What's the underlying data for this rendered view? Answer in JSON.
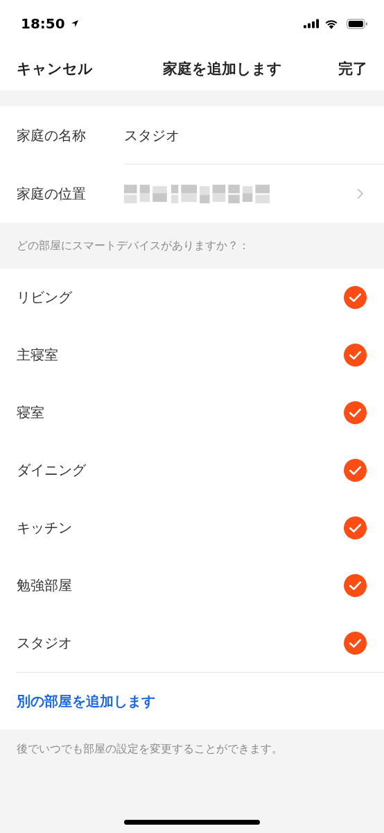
{
  "status_bar": {
    "time": "18:50"
  },
  "nav": {
    "cancel": "キャンセル",
    "title": "家庭を追加します",
    "done": "完了"
  },
  "form": [
    {
      "kind": "text",
      "label": "家庭の名称",
      "value": "スタジオ"
    },
    {
      "kind": "location",
      "label": "家庭の位置"
    }
  ],
  "rooms_header": "どの部屋にスマートデバイスがありますか？：",
  "rooms": [
    {
      "name": "リビング",
      "checked": true
    },
    {
      "name": "主寝室",
      "checked": true
    },
    {
      "name": "寝室",
      "checked": true
    },
    {
      "name": "ダイニング",
      "checked": true
    },
    {
      "name": "キッチン",
      "checked": true
    },
    {
      "name": "勉強部屋",
      "checked": true
    },
    {
      "name": "スタジオ",
      "checked": true
    }
  ],
  "add_room": "別の部屋を追加します",
  "footer_note": "後でいつでも部屋の設定を変更することができます。"
}
